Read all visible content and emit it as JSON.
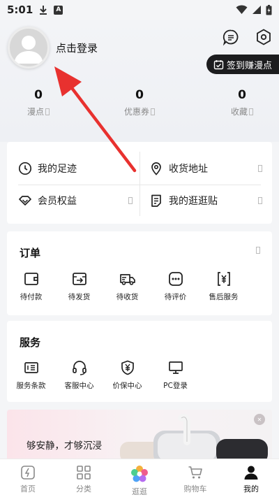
{
  "status_bar": {
    "time": "5:01",
    "notif_letter": "A"
  },
  "profile": {
    "login_text": "点击登录",
    "checkin_label": "签到赚漫点"
  },
  "stats": [
    {
      "value": "0",
      "label": "漫点"
    },
    {
      "value": "0",
      "label": "优惠券"
    },
    {
      "value": "0",
      "label": "收藏"
    }
  ],
  "quick_links": {
    "footprints": "我的足迹",
    "address": "收货地址",
    "member": "会员权益",
    "posts": "我的逛逛贴"
  },
  "orders": {
    "title": "订单",
    "items": [
      "待付款",
      "待发货",
      "待收货",
      "待评价",
      "售后服务"
    ]
  },
  "services": {
    "title": "服务",
    "items": [
      "服务条款",
      "客服中心",
      "价保中心",
      "PC登录"
    ]
  },
  "banner": {
    "slogan": "够安静，才够沉浸"
  },
  "tabs": [
    {
      "label": "首页"
    },
    {
      "label": "分类"
    },
    {
      "label": "逛逛"
    },
    {
      "label": "购物车"
    },
    {
      "label": "我的"
    }
  ],
  "colors": {
    "annotation_arrow": "#e8312f",
    "checkin_bg": "#1c1c1e"
  }
}
